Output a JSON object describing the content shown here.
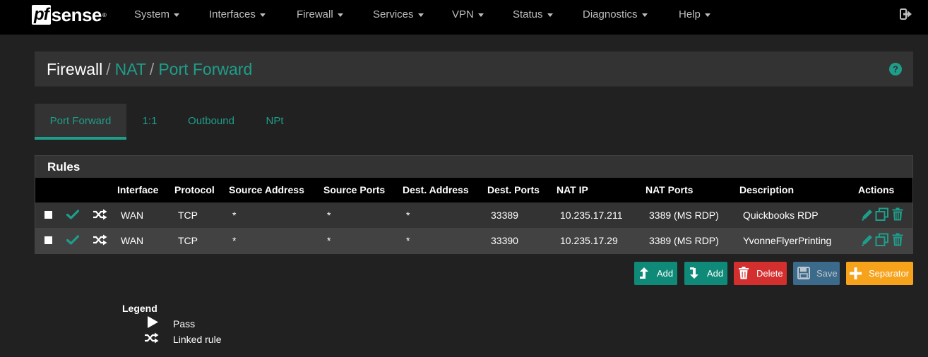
{
  "brand": {
    "logo_pf": "pf",
    "logo_sense": "sense"
  },
  "nav": {
    "items": [
      {
        "label": "System"
      },
      {
        "label": "Interfaces"
      },
      {
        "label": "Firewall"
      },
      {
        "label": "Services"
      },
      {
        "label": "VPN"
      },
      {
        "label": "Status"
      },
      {
        "label": "Diagnostics"
      },
      {
        "label": "Help"
      }
    ],
    "logout_icon": "sign-out-icon"
  },
  "breadcrumb": {
    "root": "Firewall",
    "separator": "/",
    "items": [
      "NAT",
      "Port Forward"
    ],
    "help_icon": "question-circle-icon"
  },
  "tabs": [
    {
      "label": "Port Forward",
      "active": true
    },
    {
      "label": "1:1",
      "active": false
    },
    {
      "label": "Outbound",
      "active": false
    },
    {
      "label": "NPt",
      "active": false
    }
  ],
  "rules_panel": {
    "title": "Rules",
    "columns": [
      "Interface",
      "Protocol",
      "Source Address",
      "Source Ports",
      "Dest. Address",
      "Dest. Ports",
      "NAT IP",
      "NAT Ports",
      "Description",
      "Actions"
    ],
    "rows": [
      {
        "interface": "WAN",
        "protocol": "TCP",
        "source_address": "*",
        "source_ports": "*",
        "dest_address": "*",
        "dest_ports": "33389",
        "nat_ip": "10.235.17.211",
        "nat_ports": "3389 (MS RDP)",
        "description": "Quickbooks RDP",
        "status_icon": "check-icon",
        "link_icon": "random-icon"
      },
      {
        "interface": "WAN",
        "protocol": "TCP",
        "source_address": "*",
        "source_ports": "*",
        "dest_address": "*",
        "dest_ports": "33390",
        "nat_ip": "10.235.17.29",
        "nat_ports": "3389 (MS RDP)",
        "description": "YvonneFlyerPrinting",
        "status_icon": "check-icon",
        "link_icon": "random-icon"
      }
    ],
    "action_icons": [
      "pencil-icon",
      "clone-icon",
      "trash-icon"
    ]
  },
  "buttons": {
    "add_top": "Add",
    "add_bottom": "Add",
    "delete": "Delete",
    "save": "Save",
    "separator": "Separator"
  },
  "legend": {
    "title": "Legend",
    "items": [
      {
        "icon": "play-icon",
        "label": "Pass"
      },
      {
        "icon": "random-icon",
        "label": "Linked rule"
      }
    ]
  },
  "colors": {
    "accent": "#1e9e8a",
    "background": "#212121",
    "panel": "#333333",
    "delete": "#d32f2f",
    "separator": "#f7a21b"
  }
}
